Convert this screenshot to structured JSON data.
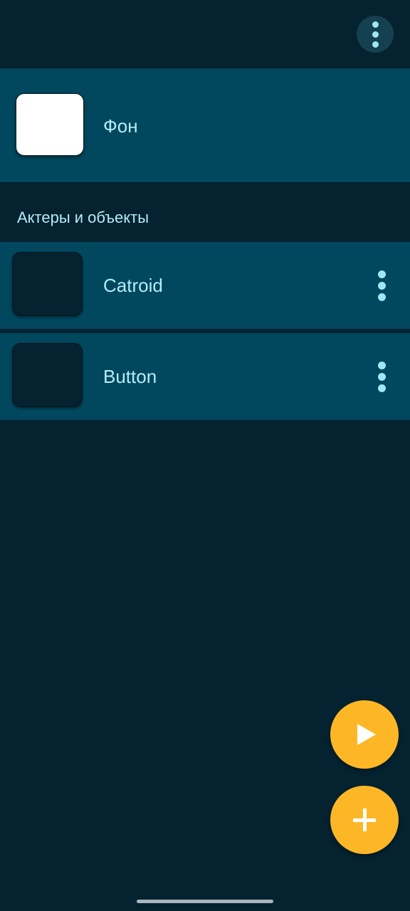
{
  "background": {
    "label": "Фон"
  },
  "section": {
    "title": "Актеры и объекты"
  },
  "sprites": [
    {
      "label": "Catroid"
    },
    {
      "label": "Button"
    }
  ],
  "icons": {
    "overflow": "more-vert-icon",
    "item_menu": "more-vert-icon",
    "play": "play-icon",
    "add": "plus-icon"
  },
  "colors": {
    "app_background": "#04222f",
    "row_background": "#01475e",
    "text": "#b4ecf7",
    "icon": "#9fe7f5",
    "fab": "#fdb726"
  }
}
